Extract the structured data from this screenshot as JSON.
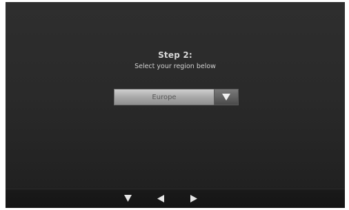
{
  "wizard": {
    "step_title": "Step 2:",
    "instruction": "Select your region below"
  },
  "region_select": {
    "selected_value": "Europe",
    "dropdown_icon": "triangle-down-icon"
  },
  "bottom_nav": {
    "buttons": [
      {
        "icon": "arrow-down-icon"
      },
      {
        "icon": "arrow-left-icon"
      },
      {
        "icon": "arrow-right-icon"
      }
    ]
  },
  "colors": {
    "background": "#2a2a2a",
    "text": "#d8d8d8",
    "select_field": "#b0b0b0",
    "select_button": "#5e5e5e",
    "nav_icon": "#e6e6e6"
  }
}
